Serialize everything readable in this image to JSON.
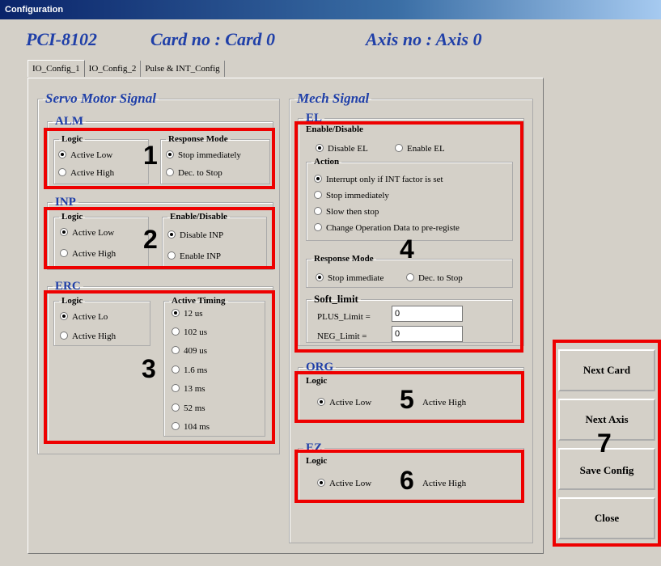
{
  "window": {
    "title": "Configuration"
  },
  "header": {
    "card_model": "PCI-8102",
    "card_no": "Card no : Card  0",
    "axis_no": "Axis no : Axis  0"
  },
  "tabs": [
    {
      "label": "IO_Config_1"
    },
    {
      "label": "IO_Config_2"
    },
    {
      "label": "Pulse & INT_Config"
    }
  ],
  "servo": {
    "title": "Servo Motor Signal",
    "alm": {
      "title": "ALM",
      "logic_label": "Logic",
      "logic_options": [
        "Active Low",
        "Active High"
      ],
      "mode_label": "Response Mode",
      "mode_options": [
        "Stop immediately",
        "Dec. to Stop"
      ]
    },
    "inp": {
      "title": "INP",
      "logic_label": "Logic",
      "logic_options": [
        "Active Low",
        "Active High"
      ],
      "enable_label": "Enable/Disable",
      "enable_options": [
        "Disable INP",
        "Enable INP"
      ]
    },
    "erc": {
      "title": "ERC",
      "logic_label": "Logic",
      "logic_options": [
        "Active Lo",
        "Active High"
      ],
      "timing_label": "Active Timing",
      "timing_options": [
        "12 us",
        "102 us",
        "409 us",
        "1.6 ms",
        "13 ms",
        "52 ms",
        "104 ms"
      ]
    }
  },
  "mech": {
    "title": "Mech Signal",
    "el": {
      "title": "EL",
      "enable_label": "Enable/Disable",
      "enable_options": [
        "Disable  EL",
        "Enable  EL"
      ],
      "action_label": "Action",
      "action_options": [
        "Interrupt only if INT factor is set",
        "Stop immediately",
        "Slow then stop",
        "Change Operation Data to pre-registe"
      ],
      "mode_label": "Response Mode",
      "mode_options": [
        "Stop immediate",
        "Dec. to Stop"
      ],
      "soft_limit": {
        "title": "Soft_limit",
        "plus_label": "PLUS_Limit =",
        "plus_value": "0",
        "neg_label": "NEG_Limit =",
        "neg_value": "0"
      }
    },
    "org": {
      "title": "ORG",
      "logic_label": "Logic",
      "options": [
        "Active Low",
        "Active High"
      ]
    },
    "ez": {
      "title": "EZ",
      "logic_label": "Logic",
      "options": [
        "Active Low",
        "Active High"
      ]
    }
  },
  "buttons": {
    "next_card": "Next Card",
    "next_axis": "Next Axis",
    "save_config": "Save Config",
    "close": "Close"
  },
  "annotations": [
    "1",
    "2",
    "3",
    "4",
    "5",
    "6",
    "7"
  ]
}
